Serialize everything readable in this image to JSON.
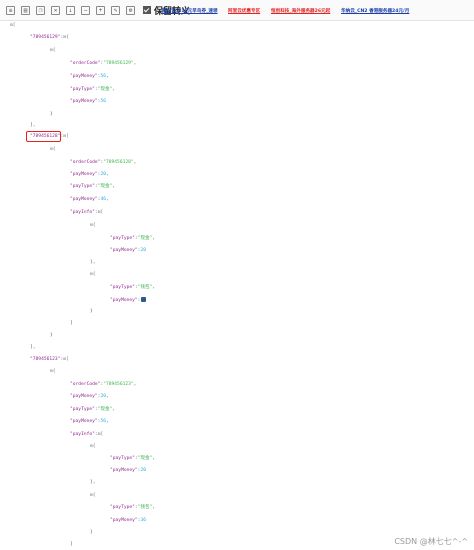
{
  "toolbar": {
    "icons": [
      "format-icon",
      "compress-icon",
      "copy-icon",
      "delete-icon",
      "download-icon",
      "collapse-icon",
      "expand-icon",
      "edit-icon",
      "settings-icon"
    ],
    "checkbox_label": "保留转义",
    "ads": [
      {
        "text": "腾讯云_618元早鸟券_速领",
        "color": "#1b3fa8"
      },
      {
        "text": "阿里云优惠专区",
        "color": "#e02424"
      },
      {
        "text": "恒创科技_海外服务器26元起",
        "color": "#e02424"
      },
      {
        "text": "华纳云_CN2 香港服务器24元/月",
        "color": "#1b3fa8"
      }
    ]
  },
  "tree": {
    "root_toggle": "⊟[",
    "items": [
      {
        "key": "\"789456129\"",
        "toggle": "⊟{",
        "obj_toggle": "⊟{",
        "fields": [
          {
            "k": "\"orderCode\"",
            "v": "\"789456129\"",
            "t": "s"
          },
          {
            "k": "\"payMoney\"",
            "v": "56",
            "t": "n"
          },
          {
            "k": "\"payType\"",
            "v": "\"现金\"",
            "t": "s"
          },
          {
            "k": "\"payMoney\"",
            "v": "56",
            "t": "n"
          }
        ],
        "close_inner": "}",
        "close_outer": "],"
      },
      {
        "key": "\"789456128\"",
        "toggle": "⊟[",
        "obj_toggle": "⊟{",
        "fields": [
          {
            "k": "\"orderCode\"",
            "v": "\"789456128\"",
            "t": "s"
          },
          {
            "k": "\"payMoney\"",
            "v": "20",
            "t": "n"
          },
          {
            "k": "\"payType\"",
            "v": "\"现金\"",
            "t": "s"
          },
          {
            "k": "\"payMoney\"",
            "v": "46",
            "t": "n"
          }
        ],
        "payinfo_key": "\"payInfo\"",
        "payinfo_toggle": "⊟[",
        "sub": [
          {
            "toggle": "⊟{",
            "fields": [
              {
                "k": "\"payType\"",
                "v": "\"现金\"",
                "t": "s"
              },
              {
                "k": "\"payMoney\"",
                "v": "20",
                "t": "n"
              }
            ],
            "close": "},"
          },
          {
            "toggle": "⊟{",
            "fields": [
              {
                "k": "\"payType\"",
                "v": "\"钱包\"",
                "t": "s"
              },
              {
                "k": "\"payMoney\"",
                "v": "",
                "t": "n"
              }
            ],
            "close": "}"
          }
        ],
        "close_payinfo": "]",
        "close_inner": "}",
        "close_outer": "],"
      },
      {
        "key": "\"789456123\"",
        "toggle": "⊟[",
        "obj_toggle": "⊟{",
        "fields": [
          {
            "k": "\"orderCode\"",
            "v": "\"789456123\"",
            "t": "s"
          },
          {
            "k": "\"payMoney\"",
            "v": "20",
            "t": "n"
          },
          {
            "k": "\"payType\"",
            "v": "\"现金\"",
            "t": "s"
          },
          {
            "k": "\"payMoney\"",
            "v": "56",
            "t": "n"
          }
        ],
        "payinfo_key": "\"payInfo\"",
        "payinfo_toggle": "⊟[",
        "sub": [
          {
            "toggle": "⊟{",
            "fields": [
              {
                "k": "\"payType\"",
                "v": "\"现金\"",
                "t": "s"
              },
              {
                "k": "\"payMoney\"",
                "v": "20",
                "t": "n"
              }
            ],
            "close": "},"
          },
          {
            "toggle": "⊟{",
            "fields": [
              {
                "k": "\"payType\"",
                "v": "\"钱包\"",
                "t": "s"
              },
              {
                "k": "\"payMoney\"",
                "v": "36",
                "t": "n"
              }
            ],
            "close": "}"
          }
        ],
        "close_payinfo": "]"
      }
    ]
  },
  "watermark": "CSDN @林七七^-^"
}
